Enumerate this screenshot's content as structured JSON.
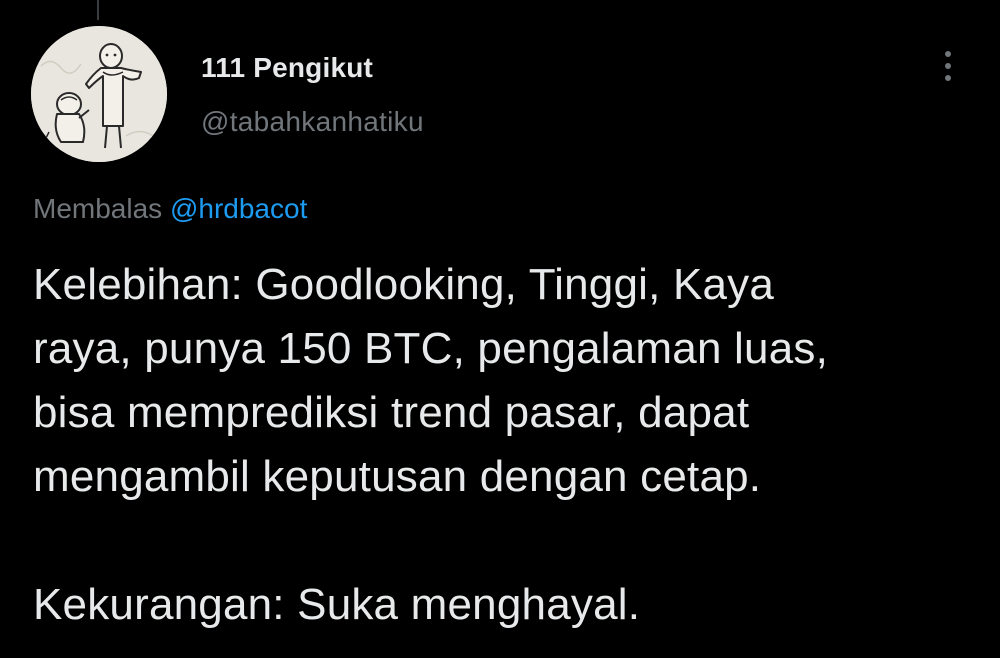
{
  "profile": {
    "display_name": "111 Pengikut",
    "handle": "@tabahkanhatiku",
    "avatar_icon": "sketch-characters-avatar"
  },
  "menu": {
    "icon": "more-vertical-icon"
  },
  "reply": {
    "prefix": "Membalas",
    "mention": "@hrdbacot"
  },
  "tweet": {
    "lines": [
      "Kelebihan: Goodlooking, Tinggi, Kaya",
      "raya, punya 150 BTC, pengalaman luas,",
      "bisa memprediksi trend pasar, dapat",
      "mengambil keputusan dengan cetap."
    ],
    "second_paragraph": "Kekurangan: Suka menghayal."
  },
  "colors": {
    "background": "#000000",
    "text_primary": "#e7e9ea",
    "text_secondary": "#71767b",
    "link": "#1d9bf0"
  }
}
